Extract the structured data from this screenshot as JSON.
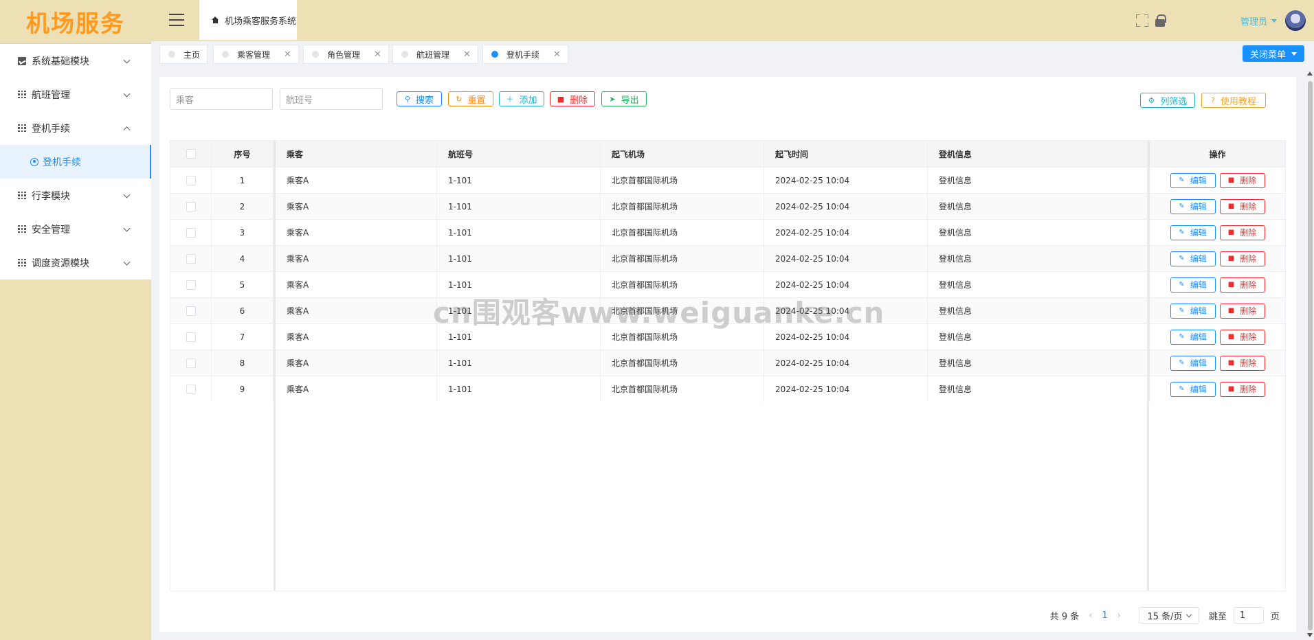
{
  "app": {
    "logo": "机场服务",
    "title": "机场乘客服务系统"
  },
  "header": {
    "user": "管理员"
  },
  "sidebar": {
    "items": [
      {
        "label": "系统基础模块"
      },
      {
        "label": "航班管理"
      },
      {
        "label": "登机手续"
      },
      {
        "label": "登机手续"
      },
      {
        "label": "行李模块"
      },
      {
        "label": "安全管理"
      },
      {
        "label": "调度资源模块"
      }
    ]
  },
  "tabs": [
    {
      "label": "主页"
    },
    {
      "label": "乘客管理"
    },
    {
      "label": "角色管理"
    },
    {
      "label": "航班管理"
    },
    {
      "label": "登机手续"
    }
  ],
  "close_menu": "关闭菜单",
  "search": {
    "passenger_placeholder": "乘客",
    "flight_placeholder": "航班号"
  },
  "toolbar": {
    "search": "搜索",
    "reset": "重置",
    "add": "添加",
    "delete": "删除",
    "export": "导出",
    "columns": "列筛选",
    "tutorial": "使用教程"
  },
  "table": {
    "headers": [
      "序号",
      "乘客",
      "航班号",
      "起飞机场",
      "起飞时间",
      "登机信息",
      "操作"
    ],
    "rows": [
      [
        "1",
        "乘客A",
        "1-101",
        "北京首都国际机场",
        "2024-02-25 10:04",
        "登机信息"
      ],
      [
        "2",
        "乘客A",
        "1-101",
        "北京首都国际机场",
        "2024-02-25 10:04",
        "登机信息"
      ],
      [
        "3",
        "乘客A",
        "1-101",
        "北京首都国际机场",
        "2024-02-25 10:04",
        "登机信息"
      ],
      [
        "4",
        "乘客A",
        "1-101",
        "北京首都国际机场",
        "2024-02-25 10:04",
        "登机信息"
      ],
      [
        "5",
        "乘客A",
        "1-101",
        "北京首都国际机场",
        "2024-02-25 10:04",
        "登机信息"
      ],
      [
        "6",
        "乘客A",
        "1-101",
        "北京首都国际机场",
        "2024-02-25 10:04",
        "登机信息"
      ],
      [
        "7",
        "乘客A",
        "1-101",
        "北京首都国际机场",
        "2024-02-25 10:04",
        "登机信息"
      ],
      [
        "8",
        "乘客A",
        "1-101",
        "北京首都国际机场",
        "2024-02-25 10:04",
        "登机信息"
      ],
      [
        "9",
        "乘客A",
        "1-101",
        "北京首都国际机场",
        "2024-02-25 10:04",
        "登机信息"
      ]
    ],
    "edit_label": "编辑",
    "delete_label": "删除"
  },
  "pager": {
    "total": "共 9 条",
    "current": "1",
    "page_size": "15 条/页",
    "jump_label": "跳至",
    "jump_value": "1",
    "page_suffix": "页"
  },
  "watermark": "cn围观客www.weiguanke.cn",
  "colors": {
    "primary": "#1890ff",
    "sidebar_bg": "#ede0b4",
    "logo": "#ff9a1e",
    "danger": "#f02e2e"
  }
}
